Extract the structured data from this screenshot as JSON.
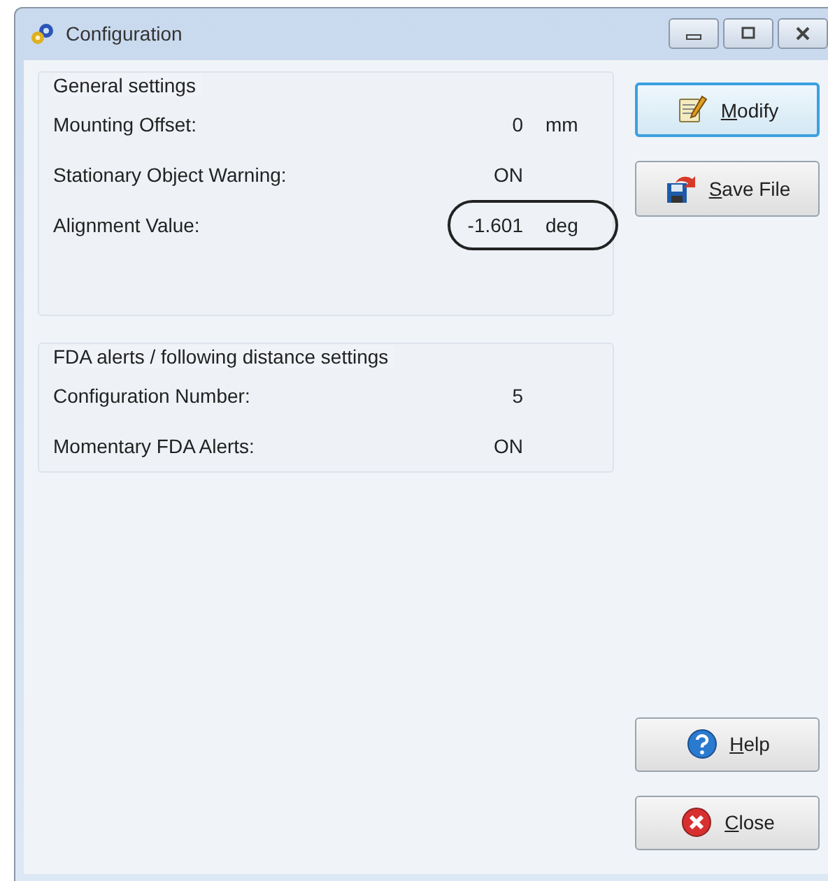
{
  "window": {
    "title": "Configuration"
  },
  "groups": [
    {
      "title": "General settings",
      "rows": [
        {
          "label": "Mounting Offset:",
          "value": "0",
          "unit": "mm",
          "highlighted": false
        },
        {
          "label": "Stationary Object Warning:",
          "value": "ON",
          "highlighted": false
        },
        {
          "label": "Alignment Value:",
          "value": "-1.601",
          "unit": "deg",
          "highlighted": true
        }
      ]
    },
    {
      "title": "FDA alerts / following distance settings",
      "rows": [
        {
          "label": "Configuration Number:",
          "value": "5",
          "highlighted": false
        },
        {
          "label": "Momentary FDA Alerts:",
          "value": "ON",
          "highlighted": false
        }
      ]
    }
  ],
  "buttons": [
    {
      "label": [
        {
          "text": "M",
          "underlined": true
        },
        {
          "text": "odify",
          "underlined": false
        }
      ],
      "kind": "modify",
      "focused": true
    },
    {
      "label": [
        {
          "text": "S",
          "underlined": true
        },
        {
          "text": "ave File",
          "underlined": false
        }
      ],
      "kind": "save",
      "focused": false
    },
    {
      "label": [
        {
          "text": "H",
          "underlined": true
        },
        {
          "text": "elp",
          "underlined": false
        }
      ],
      "kind": "help",
      "focused": false
    },
    {
      "label": [
        {
          "text": "C",
          "underlined": true
        },
        {
          "text": "lose",
          "underlined": false
        }
      ],
      "kind": "close",
      "focused": false
    }
  ]
}
